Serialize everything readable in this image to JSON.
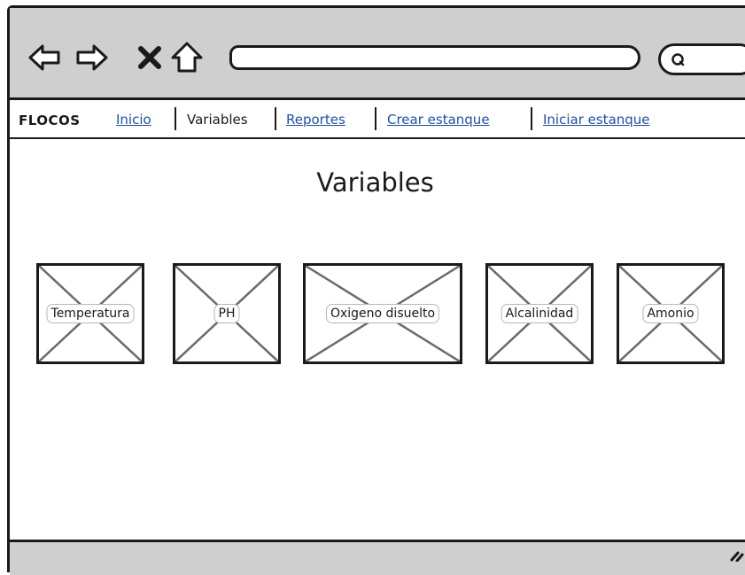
{
  "browser": {
    "back_icon": "arrow-left-icon",
    "forward_icon": "arrow-right-icon",
    "stop_icon": "close-icon",
    "home_icon": "home-icon",
    "url": "",
    "search_icon": "search-icon"
  },
  "menu": {
    "brand": "FLOCOS",
    "items": [
      {
        "label": "Inicio",
        "link": true
      },
      {
        "label": "Variables",
        "link": false
      },
      {
        "label": "Reportes",
        "link": true
      },
      {
        "label": "Crear estanque",
        "link": true
      },
      {
        "label": "Iniciar estanque",
        "link": true
      }
    ]
  },
  "main": {
    "title": "Variables",
    "tiles": [
      {
        "label": "Temperatura"
      },
      {
        "label": "PH"
      },
      {
        "label": "Oxigeno disuelto"
      },
      {
        "label": "Alcalinidad"
      },
      {
        "label": "Amonio"
      }
    ]
  },
  "colors": {
    "chrome": "#cfcfcf",
    "link": "#1f4fa8",
    "stroke": "#1a1a1a"
  }
}
